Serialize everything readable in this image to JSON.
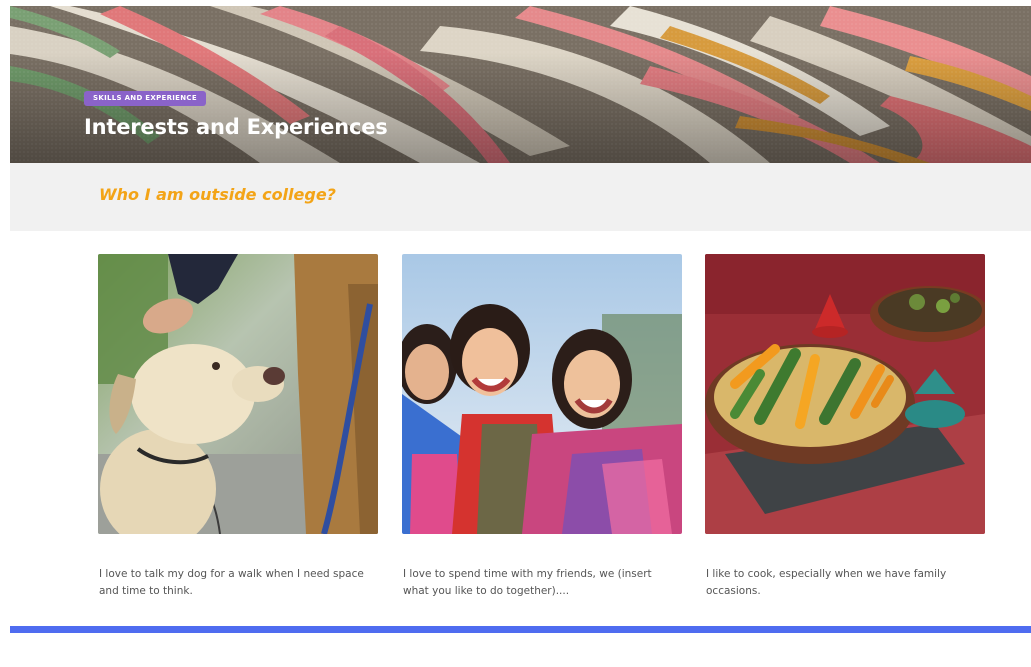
{
  "hero": {
    "badge": "SKILLS AND EXPERIENCE",
    "title": "Interests and Experiences",
    "badge_color": "#8a63c9"
  },
  "section": {
    "heading": "Who I am outside college?",
    "heading_color": "#f3a417",
    "band_color": "#f1f1f1"
  },
  "cards": [
    {
      "image": "dog-walk-photo",
      "text": "I love to talk my dog for a walk when I need space and time to think."
    },
    {
      "image": "friends-photo",
      "text": "I love to spend time with my friends, we (insert what you like to do together)...."
    },
    {
      "image": "cooking-photo",
      "text": "I like to cook, especially when we have family occasions."
    }
  ],
  "footer": {
    "accent_color": "#4f6cf0"
  }
}
